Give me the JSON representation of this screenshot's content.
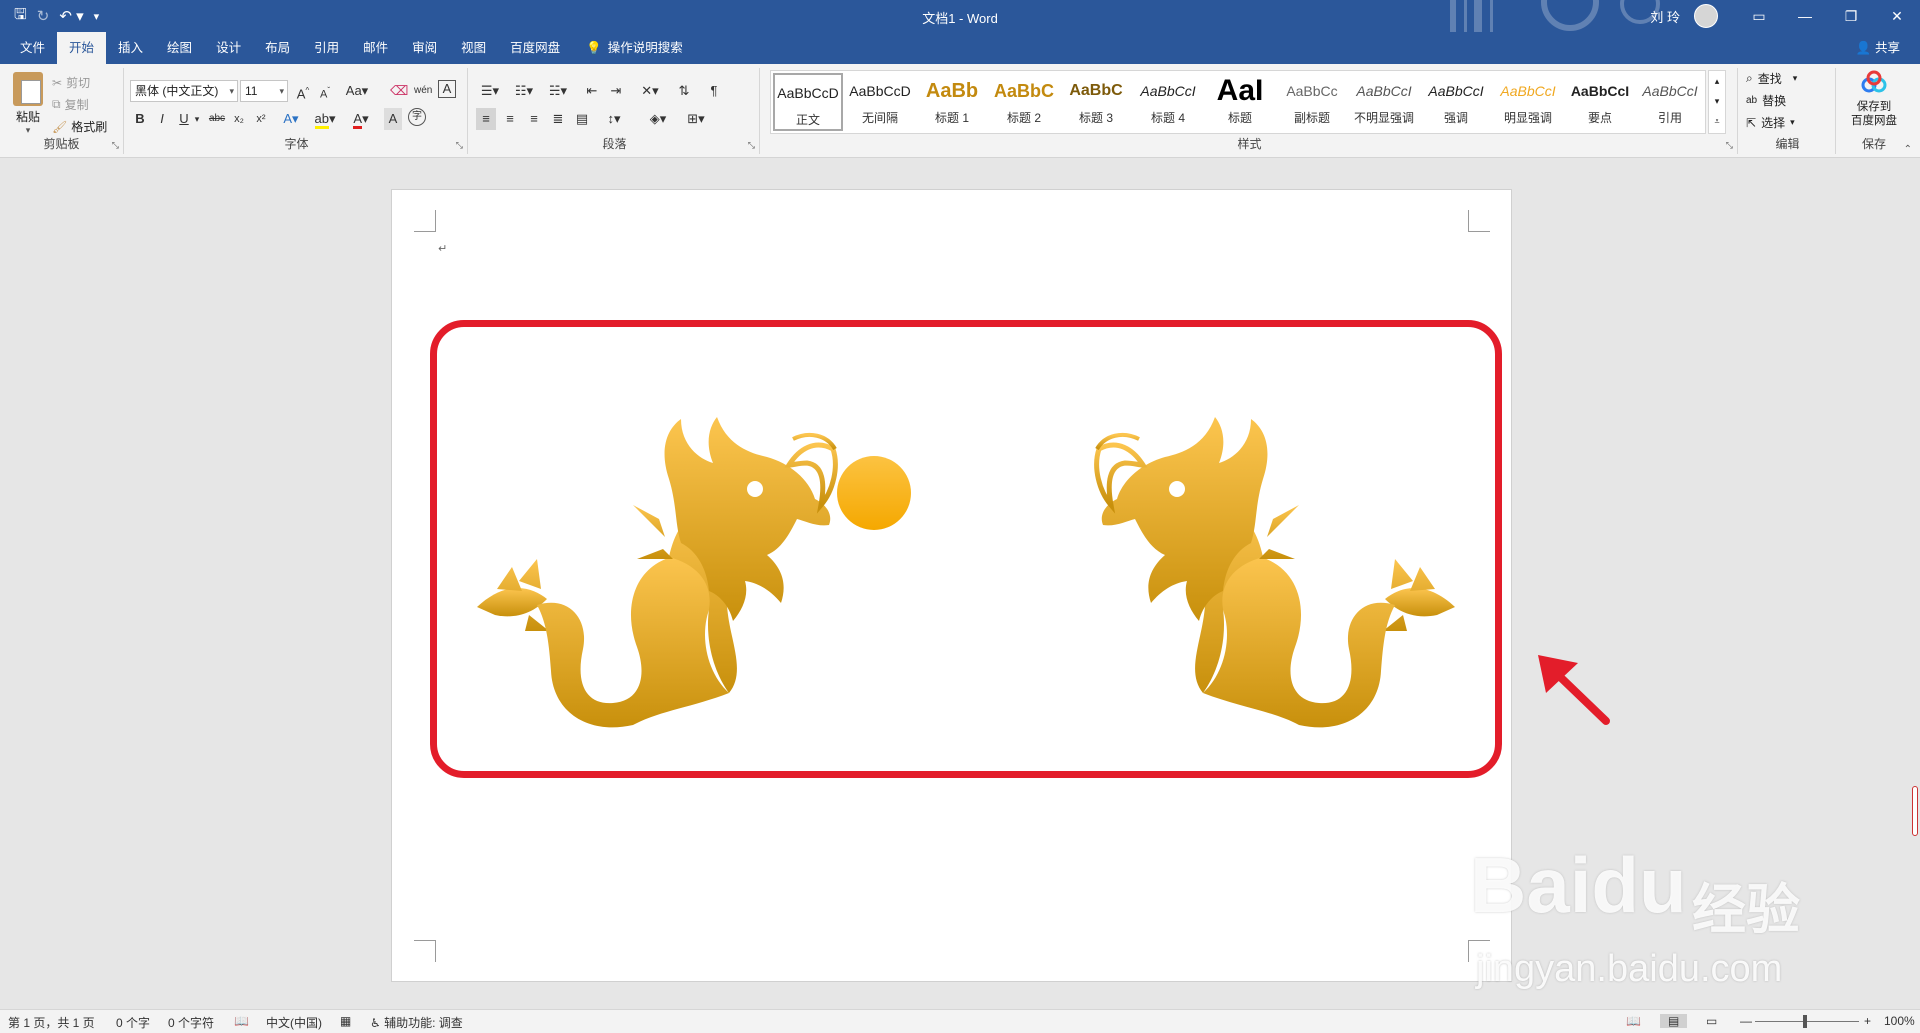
{
  "window": {
    "title": "文档1  -  Word",
    "user": "刘 玲",
    "minimize_icon": "minimize-icon",
    "maximize_icon": "restore-icon",
    "close_icon": "close-icon"
  },
  "tabs": [
    {
      "label": "文件"
    },
    {
      "label": "开始"
    },
    {
      "label": "插入"
    },
    {
      "label": "绘图"
    },
    {
      "label": "设计"
    },
    {
      "label": "布局"
    },
    {
      "label": "引用"
    },
    {
      "label": "邮件"
    },
    {
      "label": "审阅"
    },
    {
      "label": "视图"
    },
    {
      "label": "百度网盘"
    }
  ],
  "tell_me": "操作说明搜索",
  "share": "共享",
  "clipboard": {
    "paste": "粘贴",
    "cut": "剪切",
    "copy": "复制",
    "format_painter": "格式刷",
    "label": "剪贴板"
  },
  "font": {
    "name": "黑体 (中文正文)",
    "size": "11",
    "label": "字体"
  },
  "paragraph": {
    "label": "段落"
  },
  "styles": {
    "label": "样式",
    "items": [
      {
        "sample": "AaBbCcD",
        "name": "正文"
      },
      {
        "sample": "AaBbCcD",
        "name": "无间隔"
      },
      {
        "sample": "AaBb",
        "name": "标题 1"
      },
      {
        "sample": "AaBbC",
        "name": "标题 2"
      },
      {
        "sample": "AaBbC",
        "name": "标题 3"
      },
      {
        "sample": "AaBbCcI",
        "name": "标题 4"
      },
      {
        "sample": "AaI",
        "name": "标题"
      },
      {
        "sample": "AaBbCc",
        "name": "副标题"
      },
      {
        "sample": "AaBbCcI",
        "name": "不明显强调"
      },
      {
        "sample": "AaBbCcI",
        "name": "强调"
      },
      {
        "sample": "AaBbCcI",
        "name": "明显强调"
      },
      {
        "sample": "AaBbCcI",
        "name": "要点"
      },
      {
        "sample": "AaBbCcI",
        "name": "引用"
      }
    ]
  },
  "editing": {
    "find": "查找",
    "replace": "替换",
    "select": "选择",
    "label": "编辑"
  },
  "save_group": {
    "button": "保存到",
    "button2": "百度网盘",
    "label": "保存"
  },
  "status": {
    "page": "第 1 页，共 1 页",
    "words": "0 个字",
    "chars": "0 个字符",
    "language": "中文(中国)",
    "accessibility": "辅助功能: 调查",
    "zoom": "100%"
  },
  "watermark": {
    "logo": "Baidu",
    "cn": "经验",
    "url": "jingyan.baidu.com"
  },
  "colors": {
    "brand_blue": "#2b579a",
    "frame_red": "#e31d2a",
    "gold_top": "#fcc54f",
    "gold_bottom": "#c8900c",
    "heading_gold": "#c38a0f"
  }
}
